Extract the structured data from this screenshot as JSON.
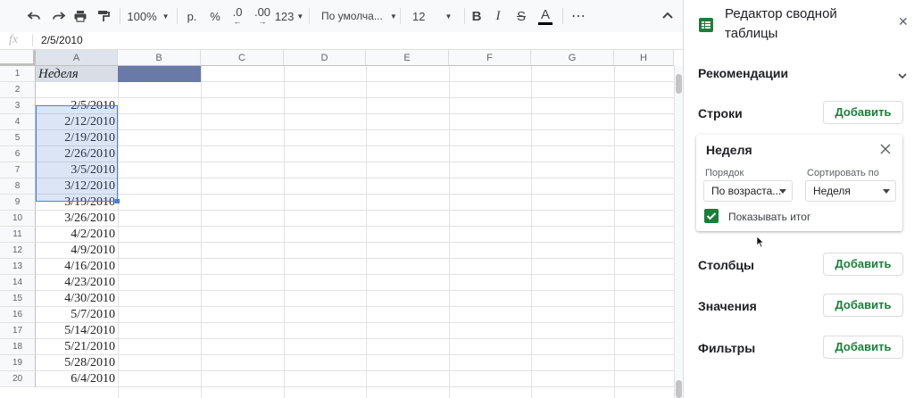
{
  "toolbar": {
    "zoom": "100%",
    "currency": "р.",
    "percent": "%",
    "dec_decrease": ".0",
    "dec_increase": ".00",
    "more_formats": "123",
    "font": "По умолча...",
    "font_size": "12",
    "bold": "B",
    "italic": "I",
    "strike": "S",
    "text_color_letter": "A",
    "more": "⋯"
  },
  "formula_bar": {
    "fx": "fx",
    "value": "2/5/2010"
  },
  "columns": [
    "A",
    "B",
    "C",
    "D",
    "E",
    "F",
    "G",
    "H"
  ],
  "rows": [
    {
      "num": "1",
      "a": "Неделя"
    },
    {
      "num": "2",
      "a": ""
    },
    {
      "num": "3",
      "a": "2/5/2010"
    },
    {
      "num": "4",
      "a": "2/12/2010"
    },
    {
      "num": "5",
      "a": "2/19/2010"
    },
    {
      "num": "6",
      "a": "2/26/2010"
    },
    {
      "num": "7",
      "a": "3/5/2010"
    },
    {
      "num": "8",
      "a": "3/12/2010"
    },
    {
      "num": "9",
      "a": "3/19/2010"
    },
    {
      "num": "10",
      "a": "3/26/2010"
    },
    {
      "num": "11",
      "a": "4/2/2010"
    },
    {
      "num": "12",
      "a": "4/9/2010"
    },
    {
      "num": "13",
      "a": "4/16/2010"
    },
    {
      "num": "14",
      "a": "4/23/2010"
    },
    {
      "num": "15",
      "a": "4/30/2010"
    },
    {
      "num": "16",
      "a": "5/7/2010"
    },
    {
      "num": "17",
      "a": "5/14/2010"
    },
    {
      "num": "18",
      "a": "5/21/2010"
    },
    {
      "num": "19",
      "a": "5/28/2010"
    },
    {
      "num": "20",
      "a": "6/4/2010"
    }
  ],
  "panel": {
    "title_line1": "Редактор сводной",
    "title_line2": "таблицы",
    "close": "✕",
    "recommendations": "Рекомендации",
    "rows_label": "Строки",
    "columns_label": "Столбцы",
    "values_label": "Значения",
    "filters_label": "Фильтры",
    "add": "Добавить",
    "card": {
      "title": "Неделя",
      "order_label": "Порядок",
      "order_value": "По возраста...",
      "sort_label": "Сортировать по",
      "sort_value": "Неделя",
      "show_totals": "Показывать итог",
      "show_totals_checked": true
    }
  },
  "colors": {
    "selection_fill": "#dce6f6",
    "selection_border": "#4a7fd4",
    "header_dark": "#6a7aa8",
    "header_light": "#d9dde5",
    "accent_green": "#188038"
  }
}
